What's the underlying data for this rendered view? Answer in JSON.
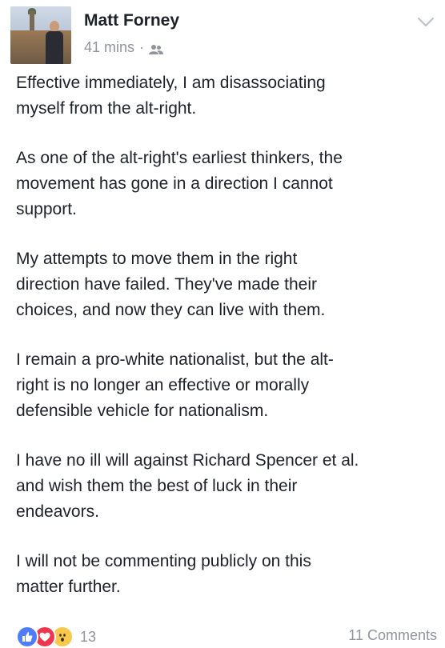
{
  "post": {
    "author": "Matt Forney",
    "time": "41 mins",
    "separator": "·",
    "audience_icon": "friends-icon",
    "menu_icon": "chevron-down-icon",
    "paragraphs": [
      "Effective immediately, I am disassociating\nmyself from the alt-right.",
      "As one of the alt-right's earliest thinkers, the\nmovement has gone in a direction I cannot\nsupport.",
      "My attempts to move them in the right\ndirection have failed. They've made their\nchoices, and now they can live with them.",
      "I remain a pro-white nationalist, but the alt-\nright is no longer an effective or morally\ndefensible vehicle for nationalism.",
      "I have no ill will against Richard Spencer et al.\nand wish them the best of luck in their\nendeavors.",
      "I will not be commenting publicly on this\nmatter further."
    ]
  },
  "footer": {
    "reactions": [
      "like-icon",
      "love-icon",
      "wow-icon"
    ],
    "reaction_count": "13",
    "comments": "11 Comments"
  },
  "colors": {
    "text": "#1d2129",
    "meta": "#90949c",
    "like": "#4f7dfa",
    "love": "#f0364f",
    "wow": "#f7c84b"
  }
}
